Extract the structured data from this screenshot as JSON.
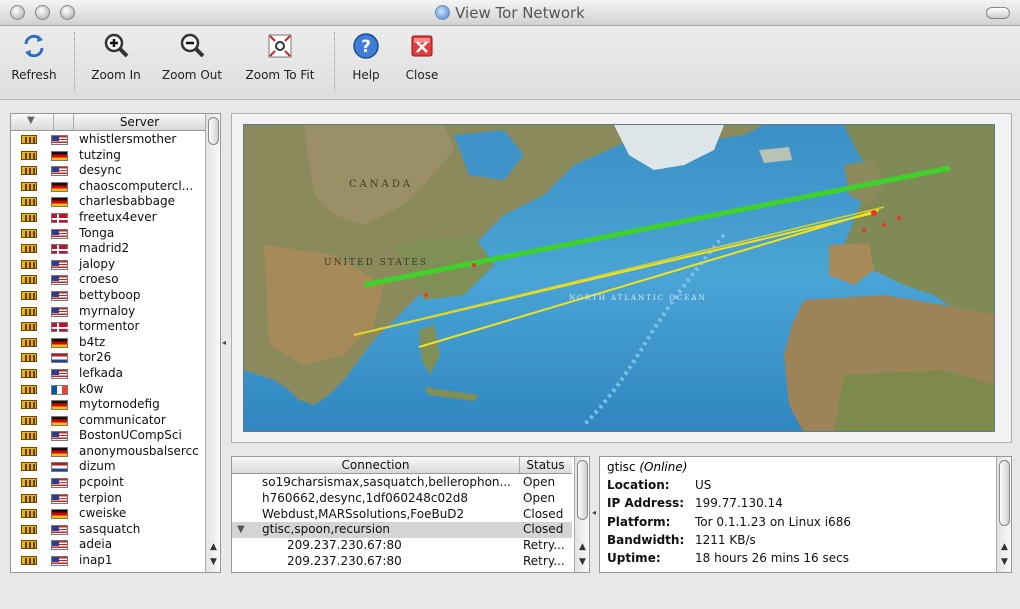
{
  "window": {
    "title": "View Tor Network"
  },
  "toolbar": {
    "refresh": "Refresh",
    "zoom_in": "Zoom In",
    "zoom_out": "Zoom Out",
    "zoom_fit": "Zoom To Fit",
    "help": "Help",
    "close": "Close"
  },
  "servers": {
    "header_sort": "▼",
    "header_server": "Server",
    "items": [
      {
        "name": "whistlersmother",
        "flag": "us"
      },
      {
        "name": "tutzing",
        "flag": "de"
      },
      {
        "name": "desync",
        "flag": "us"
      },
      {
        "name": "chaoscomputercl...",
        "flag": "de"
      },
      {
        "name": "charlesbabbage",
        "flag": "de"
      },
      {
        "name": "freetux4ever",
        "flag": "dk"
      },
      {
        "name": "Tonga",
        "flag": "us"
      },
      {
        "name": "madrid2",
        "flag": "dk"
      },
      {
        "name": "jalopy",
        "flag": "us"
      },
      {
        "name": "croeso",
        "flag": "us"
      },
      {
        "name": "bettyboop",
        "flag": "us"
      },
      {
        "name": "myrnaloy",
        "flag": "us"
      },
      {
        "name": "tormentor",
        "flag": "dk"
      },
      {
        "name": "b4tz",
        "flag": "de"
      },
      {
        "name": "tor26",
        "flag": "nl"
      },
      {
        "name": "lefkada",
        "flag": "us"
      },
      {
        "name": "k0w",
        "flag": "fr"
      },
      {
        "name": "mytornodefig",
        "flag": "de"
      },
      {
        "name": "communicator",
        "flag": "de"
      },
      {
        "name": "BostonUCompSci",
        "flag": "us"
      },
      {
        "name": "anonymousbalsercc",
        "flag": "de"
      },
      {
        "name": "dizum",
        "flag": "nl"
      },
      {
        "name": "pcpoint",
        "flag": "us"
      },
      {
        "name": "terpion",
        "flag": "us"
      },
      {
        "name": "cweiske",
        "flag": "de"
      },
      {
        "name": "sasquatch",
        "flag": "us"
      },
      {
        "name": "adeia",
        "flag": "us"
      },
      {
        "name": "inap1",
        "flag": "us"
      }
    ]
  },
  "map_labels": {
    "canada": "CANADA",
    "us": "UNITED STATES",
    "ocean": "NORTH ATLANTIC OCEAN"
  },
  "connections": {
    "header_connection": "Connection",
    "header_status": "Status",
    "rows": [
      {
        "name": "so19charsismax,sasquatch,bellerophon...",
        "status": "Open",
        "indent": 0,
        "expander": "",
        "selected": false
      },
      {
        "name": "h760662,desync,1df060248c02d8",
        "status": "Open",
        "indent": 0,
        "expander": "",
        "selected": false
      },
      {
        "name": "Webdust,MARSsolutions,FoeBuD2",
        "status": "Closed",
        "indent": 0,
        "expander": "",
        "selected": false
      },
      {
        "name": "gtisc,spoon,recursion",
        "status": "Closed",
        "indent": 0,
        "expander": "▼",
        "selected": true
      },
      {
        "name": "209.237.230.67:80",
        "status": "Retry...",
        "indent": 1,
        "expander": "",
        "selected": false
      },
      {
        "name": "209.237.230.67:80",
        "status": "Retry...",
        "indent": 1,
        "expander": "",
        "selected": false
      }
    ]
  },
  "details": {
    "name": "gtisc",
    "state": "(Online)",
    "rows": [
      {
        "label": "Location:",
        "value": "US"
      },
      {
        "label": "IP Address:",
        "value": "199.77.130.14"
      },
      {
        "label": "Platform:",
        "value": "Tor 0.1.1.23 on Linux i686"
      },
      {
        "label": "Bandwidth:",
        "value": "1211 KB/s"
      },
      {
        "label": "Uptime:",
        "value": "18 hours 26 mins 16 secs"
      }
    ]
  },
  "colors": {
    "route_green": "#3ed22a",
    "route_yellow": "#f2e21b",
    "ocean": "#3b8fc4",
    "land": "#8b8a5c"
  }
}
